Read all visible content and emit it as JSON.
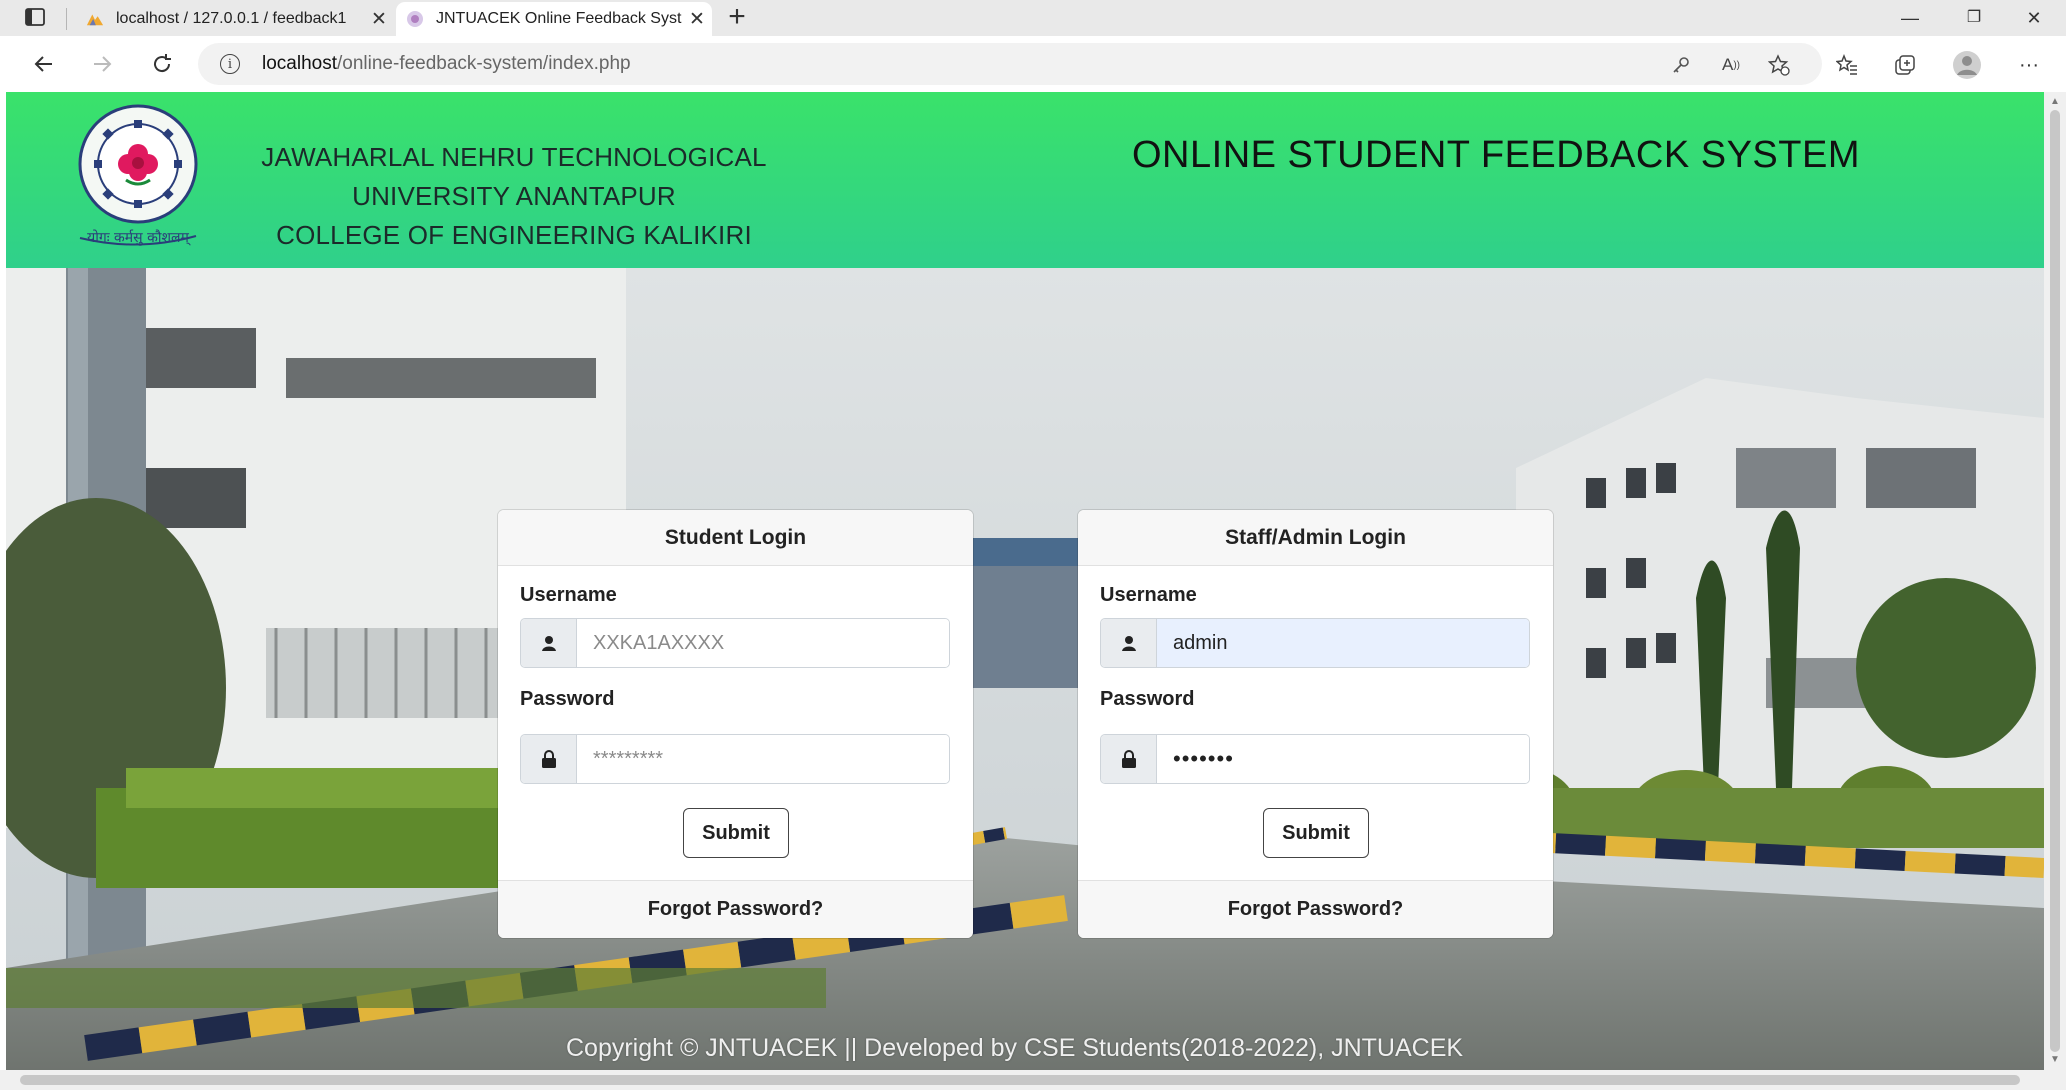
{
  "browser": {
    "tabs": [
      {
        "title": "localhost / 127.0.0.1 / feedback1",
        "favicon": "phpmyadmin-icon",
        "active": false
      },
      {
        "title": "JNTUACEK Online Feedback Syst",
        "favicon": "jntu-logo-icon",
        "active": true
      }
    ],
    "new_tab": "+",
    "window_controls": {
      "minimize": "—",
      "restore": "❐",
      "close": "✕"
    },
    "url": {
      "host": "localhost",
      "path": "/online-feedback-system/index.php"
    }
  },
  "header": {
    "university_line1": "JAWAHARLAL NEHRU TECHNOLOGICAL UNIVERSITY ANANTAPUR",
    "university_line2": "COLLEGE OF ENGINEERING KALIKIRI",
    "system_title": "ONLINE STUDENT FEEDBACK SYSTEM",
    "logo": {
      "ring_text_top": "JAWAHARLAL NEHRU TECHNOLOGICAL UNIVERSITY",
      "ring_text_bottom": "ANANTAPUR",
      "motto": "योगः कर्मसु कौशलम्"
    }
  },
  "student_login": {
    "title": "Student Login",
    "username_label": "Username",
    "username_placeholder": "XXKA1AXXXX",
    "password_label": "Password",
    "password_placeholder": "*********",
    "submit": "Submit",
    "forgot": "Forgot Password?"
  },
  "staff_login": {
    "title": "Staff/Admin Login",
    "username_label": "Username",
    "username_value": "admin",
    "password_label": "Password",
    "password_value": "•••••••",
    "submit": "Submit",
    "forgot": "Forgot Password?"
  },
  "footer": {
    "copyright": "Copyright © JNTUACEK || Developed by CSE Students(2018-2022), JNTUACEK"
  },
  "colors": {
    "header_green": "#3ae26a",
    "header_green_bottom": "#2fd08b",
    "autofill_blue": "#e8f0fe"
  }
}
